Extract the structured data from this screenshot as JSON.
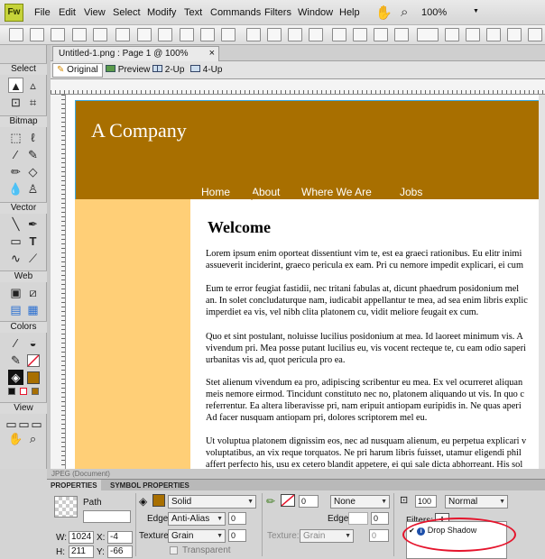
{
  "app": {
    "logo": "Fw"
  },
  "menu": [
    "File",
    "Edit",
    "View",
    "Select",
    "Modify",
    "Text",
    "Commands",
    "Filters",
    "Window",
    "Help"
  ],
  "menubar": {
    "zoom": "100%",
    "zoom_arrow": "▼",
    "hand_icon": "✋",
    "search_icon": "⌕"
  },
  "document": {
    "tab_title": "Untitled-1.png : Page 1 @ 100% (Path)*",
    "close": "×"
  },
  "views": {
    "original": "Original",
    "preview": "Preview",
    "two_up": "2-Up",
    "four_up": "4-Up"
  },
  "ruler": {
    "labels": [
      "",
      "",
      "",
      "",
      "",
      "",
      "",
      "",
      "",
      "",
      "",
      ""
    ]
  },
  "tools": {
    "sections": [
      "Select",
      "Bitmap",
      "Vector",
      "Web",
      "Colors",
      "View"
    ]
  },
  "page": {
    "company": "A Company",
    "nav": [
      "Home",
      "About",
      "Where We Are",
      "Jobs"
    ],
    "welcome": "Welcome",
    "paragraphs": [
      "Lorem ipsum enim oporteat dissentiunt vim te, est ea graeci rationibus. Eu elitr inimi\nassueverit inciderint, graeco pericula ex eam. Pri cu nemore impedit explicari, ei cum",
      "Eum te error feugiat fastidii, nec tritani fabulas at, dicunt phaedrum posidonium mel\nan. In solet concludaturque nam, iudicabit appellantur te mea, ad sea enim libris explic\nimperdiet ea vis, vel nibh clita platonem cu, vidit meliore feugait ex cum.",
      "Quo et sint postulant, noluisse lucilius posidonium at mea. Id laoreet minimum vis. A\nvivendum pri. Mea posse putant lucilius eu, vis vocent recteque te, cu eam odio saperi\nurbanitas vis ad, quot pericula pro ea.",
      "Stet alienum vivendum ea pro, adipiscing scribentur eu mea. Ex vel ocurreret aliquan\nmeis nemore eirmod. Tincidunt constituto nec no, platonem aliquando ut vis. In quo c\nreferrentur. Ea altera liberavisse pri, nam eripuit antiopam euripidis in. Ne quas aperi\nAd facer nusquam antiopam pri, dolores scriptorem mel eu.",
      "Ut voluptua platonem dignissim eos, nec ad nusquam alienum, eu perpetua explicari v\nvoluptatibus, an vix reque torquatos. Ne pri harum libris fuisset, utamur eligendi phil\naffert perfecto his, usu ex cetero blandit appetere, ei qui sale dicta abhorreant. His sol"
    ]
  },
  "status": {
    "label": "JPEG (Document)"
  },
  "properties": {
    "tabs": [
      "PROPERTIES",
      "SYMBOL PROPERTIES"
    ],
    "path_label": "Path",
    "w_label": "W:",
    "w": "1024",
    "x_label": "X:",
    "x": "-4",
    "h_label": "H:",
    "h": "211",
    "y_label": "Y:",
    "y": "-66",
    "fill_type": "Solid",
    "edge_label": "Edge:",
    "edge": "Anti-Alias",
    "edge_val": "0",
    "texture_label": "Texture:",
    "texture": "Grain",
    "texture_val": "0",
    "transparent": "Transparent",
    "stroke_size": "0",
    "stroke_type": "None",
    "stroke_edge_label": "Edge:",
    "stroke_edge_val": "0",
    "stroke_texture_label": "Texture:",
    "stroke_texture": "Grain",
    "stroke_texture_val": "0",
    "opacity": "100",
    "blend": "Normal",
    "filters_label": "Filters:",
    "filters_add": "+",
    "filters_remove": "−",
    "filter_item": "Drop Shadow",
    "filter_check": "✔",
    "filter_info": "i"
  },
  "colors": {
    "fill": "#a86f00",
    "header": "#a86f00",
    "sidebar": "#ffcf77",
    "annotation": "#e5142c"
  }
}
